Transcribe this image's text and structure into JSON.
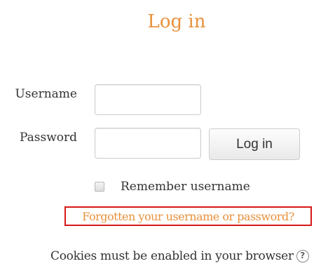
{
  "page": {
    "title": "Log in"
  },
  "form": {
    "username_label": "Username",
    "username_value": "",
    "password_label": "Password",
    "password_value": "",
    "login_button_label": "Log in",
    "remember_label": "Remember username",
    "remember_checked": false
  },
  "links": {
    "forgot_label": "Forgotten your username or password?"
  },
  "footer": {
    "cookies_text": "Cookies must be enabled in your browser",
    "help_icon_glyph": "?"
  },
  "icons": {
    "help": "help-icon"
  },
  "colors": {
    "accent": "#e8913c",
    "highlight_border": "#d81818",
    "text": "#333333"
  }
}
